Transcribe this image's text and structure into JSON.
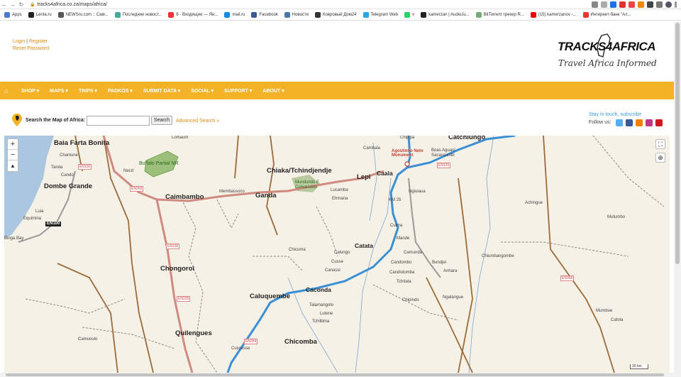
{
  "browser": {
    "url": "tracks4africa.co.za/maps/africa/",
    "bookmarks": [
      {
        "label": "Apps",
        "color": "#4a7bd0"
      },
      {
        "label": "Lenta.ru",
        "color": "#222"
      },
      {
        "label": "NEWSru.com :: Сам...",
        "color": "#555"
      },
      {
        "label": "Последние новост...",
        "color": "#4a9"
      },
      {
        "label": "6 · Входящие — Ян...",
        "color": "#e33"
      },
      {
        "label": "mail.ru",
        "color": "#168de2"
      },
      {
        "label": "Facebook",
        "color": "#3b5998"
      },
      {
        "label": "Новости",
        "color": "#4a76a8"
      },
      {
        "label": "Ковровый Дом24",
        "color": "#333"
      },
      {
        "label": "Telegram Web",
        "color": "#2ca5e0"
      },
      {
        "label": "v",
        "color": "#25d366"
      },
      {
        "label": "kamerzan | AudioJu...",
        "color": "#222"
      },
      {
        "label": "BitTorrent трекер R...",
        "color": "#7a7"
      },
      {
        "label": "(15) kamerzanov -...",
        "color": "#e00"
      },
      {
        "label": "Интернет-банк \"Ал...",
        "color": "#e33"
      }
    ]
  },
  "header": {
    "login": "Login",
    "sep": "|",
    "register": "Register",
    "reset": "Reset Password",
    "logo_left": "TRACKS",
    "logo_num": "4",
    "logo_right": "AFRICA",
    "tagline": "Travel Africa Informed"
  },
  "nav": {
    "items": [
      "SHOP ▾",
      "MAPS ▾",
      "TRIPS ▾",
      "PADKOS ▾",
      "SUBMIT DATA ▾",
      "SOCIAL ▾",
      "SUPPORT ▾",
      "ABOUT ▾"
    ]
  },
  "search": {
    "label": "Search the Map of Africa:",
    "value": "",
    "button": "Search",
    "advanced": "Advanced Search »",
    "stay": "Stay in touch, subscribe",
    "follow": "Follow us:"
  },
  "map": {
    "zoom_in": "+",
    "zoom_out": "−",
    "north": "▲",
    "scale": "30 km",
    "labels": {
      "baia_farta": "Baia Farta Bonita",
      "chamune": "Chamune",
      "tanda": "Tanda",
      "cando": "Cando",
      "dombe": "Dombe Grande",
      "luia": "Luia",
      "equimina": "Equimina",
      "binga": "Binga Bay",
      "lomaum": "Lomaum",
      "necd": "Necd",
      "buffalo": "Buffalo Partial NR",
      "caimbambo": "Caimbambo",
      "membassoco": "Membassoco",
      "chongoroi": "Chongoroi",
      "quilengues": "Quilengues",
      "camuoulo": "Camuoulo",
      "chiaka": "Chiaka/Tchindjendje",
      "ganda": "Ganda",
      "mundundo": "Mundundo E Concession",
      "lepi": "Lepi",
      "caala": "Caala",
      "lucamba": "Lucamba",
      "ehmana": "Ehmana",
      "cambala": "Cambala",
      "chipipa": "Chipipa",
      "agostinho": "Agostinho Neto Monument",
      "catchiungo": "Catchiungo",
      "boas_aguas": "Boas Aguas/ Sacassumbi",
      "ngiuiaua": "Ngiuiaua",
      "km25": "KM 25",
      "cuima": "Cuima",
      "mande": "Mande",
      "chicuma": "Chicuma",
      "calungo": "Calungo",
      "catata": "Catata",
      "cusse": "Cusse",
      "canassi": "Canassi",
      "camunda": "Camunda",
      "candombo": "Candombo",
      "candiolomba": "Candiolomba",
      "tchitata": "Tchitata",
      "bundjei": "Bundjei",
      "anhara": "Anhara",
      "caconda": "Caconda",
      "caluquembe": "Caluquembe",
      "talamangolo": "Talamangolo",
      "lutene": "Lutene",
      "tchilliima": "Tchilliima",
      "chipindo": "Chipindo",
      "ngalangue": "Ngalangue",
      "chicomba": "Chicomba",
      "cussesse": "Cussesse",
      "achingue": "Achingue",
      "mutumbo": "Mutumbo",
      "chiumbangombe": "Chiumbangombe",
      "mumbue": "Mumbue",
      "catola": "Catola"
    },
    "shields": {
      "en100": "EN100",
      "en100a": "EN100",
      "en260a": "EN260",
      "en105": "EN105",
      "en105b": "EN105",
      "en120": "EN120",
      "en354": "EN354",
      "en358": "EN358"
    }
  }
}
